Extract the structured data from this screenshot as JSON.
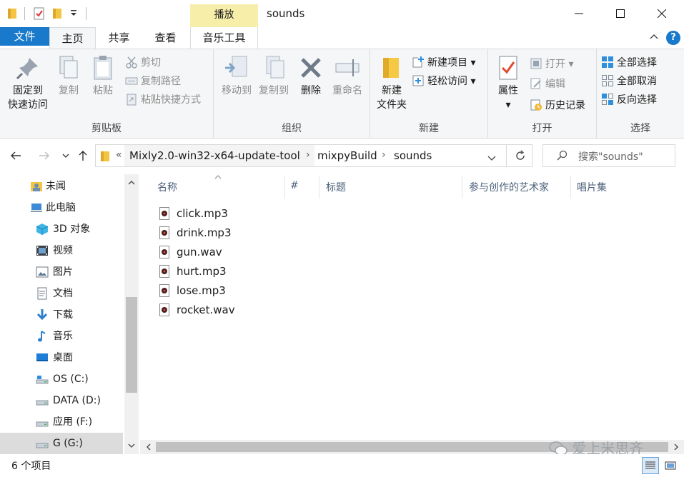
{
  "window": {
    "title": "sounds",
    "context_tab": "播放"
  },
  "ribbon_tabs": [
    "文件",
    "主页",
    "共享",
    "查看",
    "音乐工具"
  ],
  "ribbon": {
    "clipboard": {
      "label": "剪贴板",
      "pin_line1": "固定到",
      "pin_line2": "快速访问",
      "copy": "复制",
      "paste": "粘贴",
      "cut": "剪切",
      "copy_path": "复制路径",
      "paste_shortcut": "粘贴快捷方式"
    },
    "organize": {
      "label": "组织",
      "move_to": "移动到",
      "copy_to": "复制到",
      "delete": "删除",
      "rename": "重命名"
    },
    "new": {
      "label": "新建",
      "new_folder_line1": "新建",
      "new_folder_line2": "文件夹",
      "new_item": "新建项目",
      "easy_access": "轻松访问"
    },
    "open": {
      "label": "打开",
      "properties": "属性",
      "open": "打开",
      "edit": "编辑",
      "history": "历史记录"
    },
    "select": {
      "label": "选择",
      "select_all": "全部选择",
      "select_none": "全部取消",
      "invert": "反向选择"
    }
  },
  "address": {
    "overflow": "«",
    "crumbs": [
      "Mixly2.0-win32-x64-update-tool",
      "mixpyBuild",
      "sounds"
    ],
    "search_placeholder": "搜索\"sounds\""
  },
  "sidebar": {
    "items": [
      {
        "label": "未闻",
        "icon": "user-folder-icon"
      },
      {
        "label": "此电脑",
        "icon": "computer-icon"
      },
      {
        "label": "3D 对象",
        "icon": "3d-objects-icon"
      },
      {
        "label": "视频",
        "icon": "video-icon"
      },
      {
        "label": "图片",
        "icon": "pictures-icon"
      },
      {
        "label": "文档",
        "icon": "documents-icon"
      },
      {
        "label": "下载",
        "icon": "download-icon"
      },
      {
        "label": "音乐",
        "icon": "music-icon"
      },
      {
        "label": "桌面",
        "icon": "desktop-icon"
      },
      {
        "label": "OS (C:)",
        "icon": "drive-icon"
      },
      {
        "label": "DATA (D:)",
        "icon": "drive-icon"
      },
      {
        "label": "应用 (F:)",
        "icon": "drive-icon"
      },
      {
        "label": "G (G:)",
        "icon": "drive-icon"
      }
    ]
  },
  "columns": [
    "名称",
    "#",
    "标题",
    "参与创作的艺术家",
    "唱片集"
  ],
  "files": [
    "click.mp3",
    "drink.mp3",
    "gun.wav",
    "hurt.mp3",
    "lose.mp3",
    "rocket.wav"
  ],
  "status": {
    "count": "6 个项目"
  },
  "watermark": "爱上米思齐",
  "colors": {
    "accent": "#1979ca",
    "context_tab": "#f7eeaa",
    "ribbon_bg": "#f5f6f7"
  }
}
